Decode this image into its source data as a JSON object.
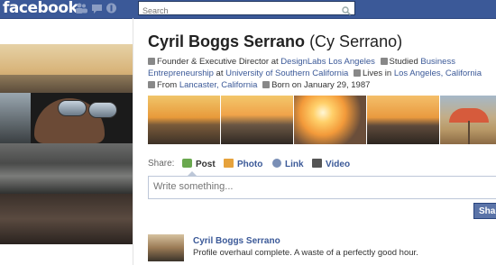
{
  "topbar": {
    "logo": "facebook",
    "search_placeholder": "Search",
    "jewels": [
      "friend-requests-icon",
      "messages-icon",
      "notifications-icon"
    ]
  },
  "profile": {
    "name": "Cyril Boggs Serrano",
    "alt_name": "(Cy Serrano)",
    "info": {
      "work_prefix": "Founder & Executive Director at",
      "work_link": "DesignLabs Los Angeles",
      "study_prefix": "Studied",
      "study_link_1": "Business Entrepreneurship",
      "study_at": "at",
      "study_link_2": "University of Southern California",
      "lives_prefix": "Lives in",
      "lives_link": "Los Angeles, California",
      "from_prefix": "From",
      "from_link": "Lancaster, California",
      "born": "Born on January 29, 1987"
    }
  },
  "share": {
    "label": "Share:",
    "post": "Post",
    "photo": "Photo",
    "link": "Link",
    "video": "Video"
  },
  "composer": {
    "placeholder": "Write something..."
  },
  "share_button": "Sha",
  "story": {
    "author": "Cyril Boggs Serrano",
    "text": "Profile overhaul complete. A waste of a perfectly good hour."
  },
  "colors": {
    "brand": "#3b5998",
    "link": "#3b5998"
  }
}
